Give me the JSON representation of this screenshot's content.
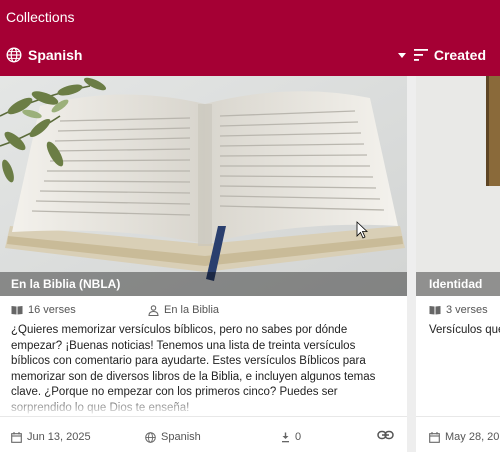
{
  "header": {
    "title": "Collections",
    "language_label": "Spanish",
    "sort_label": "Created"
  },
  "cards": [
    {
      "title": "En la Biblia (NBLA)",
      "verses": "16 verses",
      "author": "En la Biblia",
      "description": "¿Quieres memorizar versículos bíblicos, pero no sabes por dónde empezar? ¡Buenas noticias! Tenemos una lista de treinta versículos bíblicos con comentario para ayudarte. Estes versículos Bíblicos para memorizar son de diversos libros de la Biblia, e incluyen algunos temas clave. ¿Porque no empezar con los primeros cinco? Puedes ser sorprendido lo que Dios te enseña!",
      "date": "Jun 13, 2025",
      "language": "Spanish",
      "downloads": "0"
    },
    {
      "title": "Identidad",
      "verses": "3 verses",
      "description": "Versículos que",
      "date": "May 28, 20"
    }
  ],
  "colors": {
    "appbar": "#a50034"
  },
  "icons": [
    "globe-icon",
    "sort-icon",
    "book-icon",
    "person-icon",
    "calendar-icon",
    "download-icon",
    "link-icon"
  ]
}
